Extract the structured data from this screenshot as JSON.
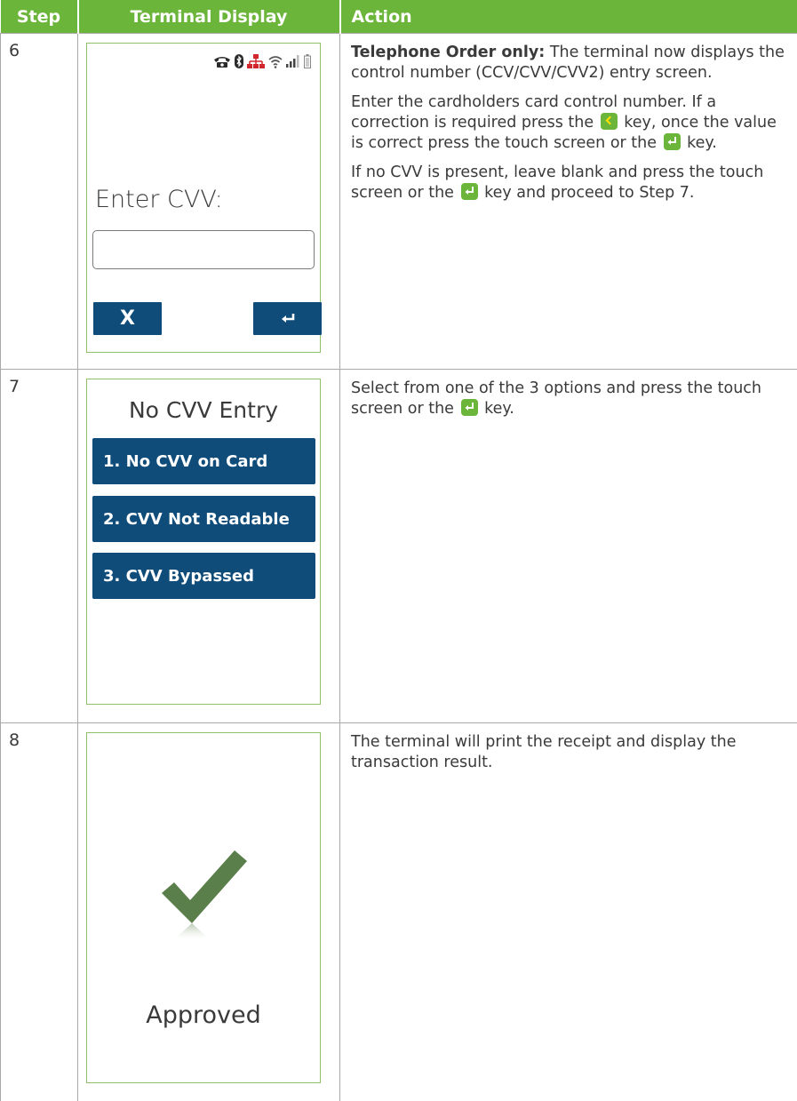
{
  "header": {
    "step": "Step",
    "terminal_display": "Terminal Display",
    "action": "Action"
  },
  "colors": {
    "header_green": "#6bb53a",
    "button_blue": "#0f4c7a",
    "check_green": "#5a7f4a"
  },
  "rows": [
    {
      "step": "6",
      "terminal": {
        "status_icons": [
          "telephone-icon",
          "bluetooth-icon",
          "network-icon",
          "wifi-icon",
          "signal-bars-icon",
          "battery-icon"
        ],
        "prompt": "Enter CVV:",
        "field_value": "",
        "cancel_button": "X",
        "enter_button": "↵"
      },
      "action": {
        "p1_bold": "Telephone Order only:",
        "p1_rest": " The terminal now displays the control number (CCV/CVV/CVV2) entry screen.",
        "p2_a": "Enter the cardholders card control number. If a correction is required press the",
        "p2_b": " key, once the value is correct press the touch screen or the",
        "p2_c": " key.",
        "p3_a": "If no CVV is present, leave blank and press the touch screen or the",
        "p3_b": " key and proceed to Step 7."
      }
    },
    {
      "step": "7",
      "terminal": {
        "title": "No CVV Entry",
        "options": [
          "1. No CVV on Card",
          "2. CVV Not Readable",
          "3. CVV Bypassed"
        ]
      },
      "action": {
        "p1_a": "Select from one of the 3 options and press the touch screen or the",
        "p1_b": " key."
      }
    },
    {
      "step": "8",
      "terminal": {
        "result": "Approved"
      },
      "action": {
        "p1": "The terminal will print the receipt and display the transaction result."
      }
    }
  ]
}
